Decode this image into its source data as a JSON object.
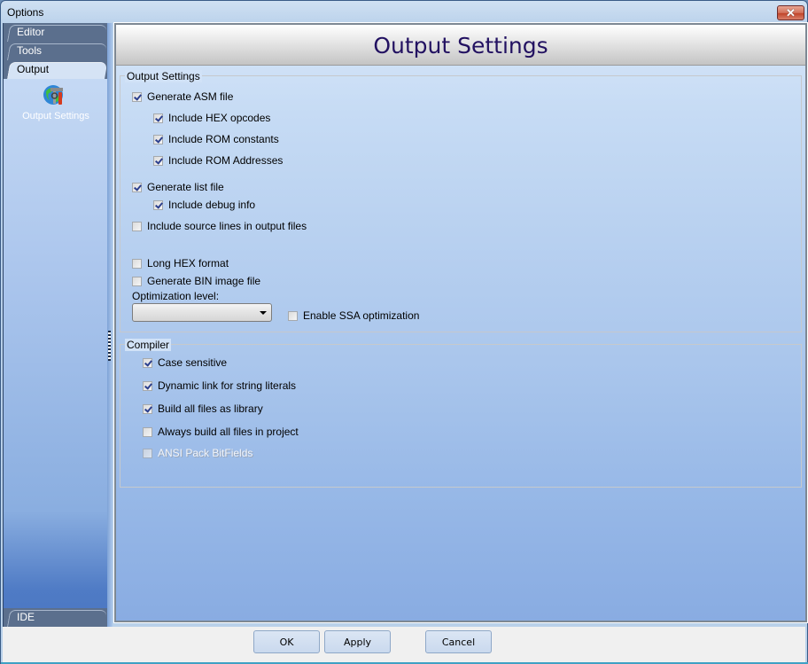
{
  "window": {
    "title": "Options",
    "close_icon": "close-icon"
  },
  "sidebar": {
    "tabs": [
      {
        "label": "Editor",
        "active": false
      },
      {
        "label": "Tools",
        "active": false
      },
      {
        "label": "Output",
        "active": true
      },
      {
        "label": "IDE",
        "active": false
      }
    ],
    "items": [
      {
        "label": "Output Settings",
        "icon": "output-settings-icon"
      }
    ]
  },
  "content": {
    "header_title": "Output Settings",
    "output_group": {
      "legend": "Output Settings",
      "options": [
        {
          "label": "Generate ASM file",
          "checked": true
        },
        {
          "label": "Include HEX opcodes",
          "checked": true
        },
        {
          "label": "Include ROM constants",
          "checked": true
        },
        {
          "label": "Include ROM Addresses",
          "checked": true
        },
        {
          "label": "Generate list file",
          "checked": true
        },
        {
          "label": "Include debug info",
          "checked": true
        },
        {
          "label": "Include source lines in output files",
          "checked": false
        },
        {
          "label": "Long HEX format",
          "checked": false
        },
        {
          "label": "Generate BIN image file",
          "checked": false
        },
        {
          "label": "Enable SSA optimization",
          "checked": false
        }
      ],
      "optimization_label": "Optimization level:",
      "optimization_value": ""
    },
    "compiler_group": {
      "legend": "Compiler",
      "options": [
        {
          "label": "Case sensitive",
          "checked": true
        },
        {
          "label": "Dynamic link for string literals",
          "checked": true
        },
        {
          "label": "Build all files as library",
          "checked": true
        },
        {
          "label": "Always build all files in project",
          "checked": false
        },
        {
          "label": "ANSI Pack BitFields",
          "checked": false,
          "disabled": true
        }
      ]
    }
  },
  "footer": {
    "ok_label": "OK",
    "apply_label": "Apply",
    "cancel_label": "Cancel"
  }
}
